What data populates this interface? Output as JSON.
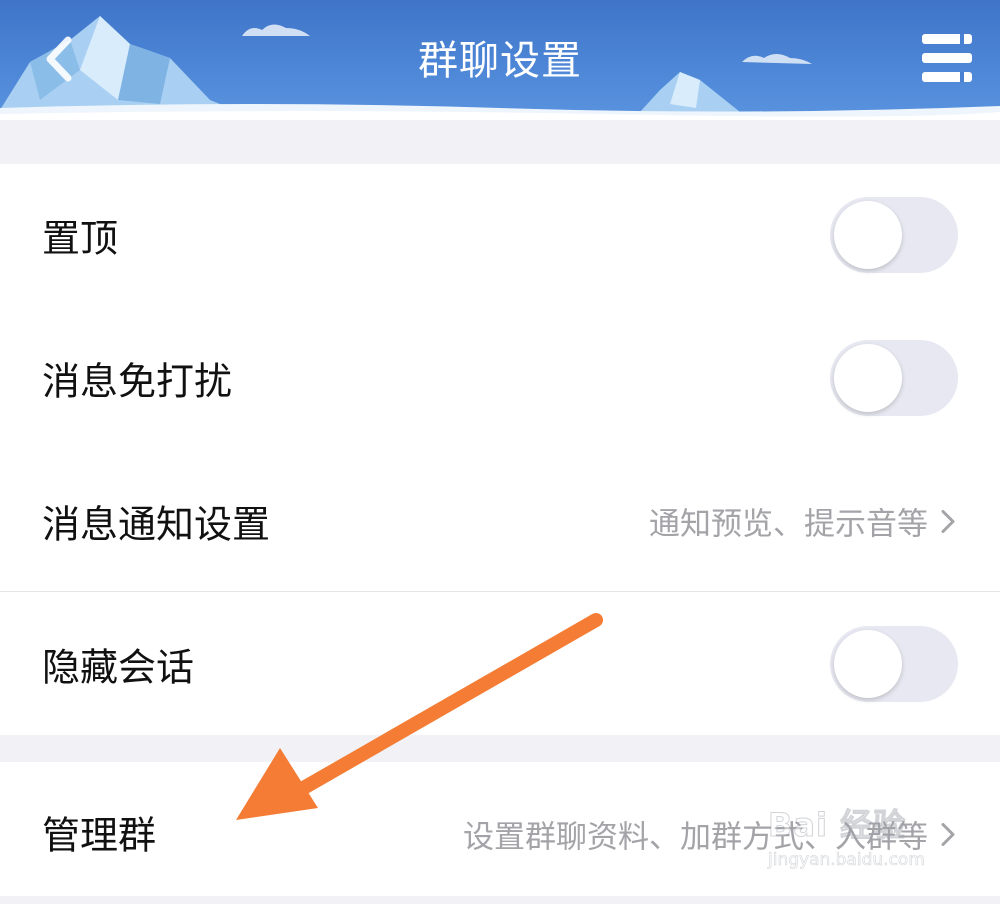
{
  "header": {
    "title": "群聊设置"
  },
  "settings": {
    "group1": [
      {
        "label": "置顶",
        "type": "toggle",
        "on": false
      },
      {
        "label": "消息免打扰",
        "type": "toggle",
        "on": false
      },
      {
        "label": "消息通知设置",
        "type": "detail",
        "detail": "通知预览、提示音等"
      },
      {
        "label": "隐藏会话",
        "type": "toggle",
        "on": false
      }
    ],
    "group2": [
      {
        "label": "管理群",
        "type": "detail",
        "detail": "设置群聊资料、加群方式、⼊群等"
      }
    ]
  },
  "watermark": {
    "brand": "Bai 经验",
    "url": "jingyan.baidu.com"
  },
  "colors": {
    "header": "#4a80d2",
    "arrow": "#f47c34",
    "toggle_off": "#e7e8f1",
    "secondary_text": "#a3a3a8"
  }
}
